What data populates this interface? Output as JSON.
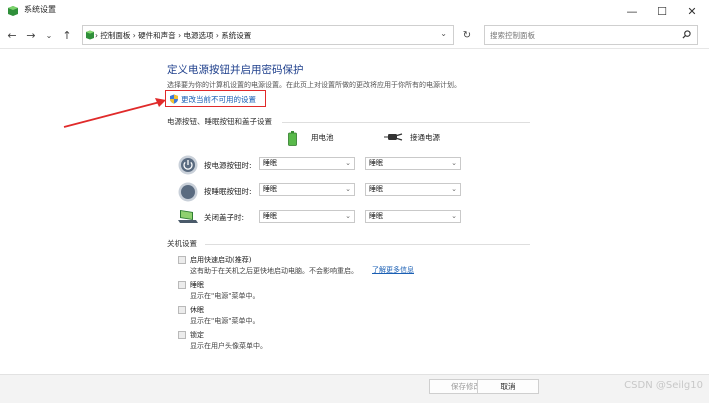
{
  "window": {
    "title": "系统设置",
    "controls": {
      "minimize": "—",
      "maximize": "☐",
      "close": "✕"
    }
  },
  "nav": {
    "breadcrumb": [
      "控制面板",
      "硬件和声音",
      "电源选项",
      "系统设置"
    ],
    "search_placeholder": "搜索控制面板",
    "icons": [
      "back-arrow-icon",
      "forward-arrow-icon",
      "chevron-down-icon",
      "up-arrow-icon",
      "refresh-icon",
      "search-icon"
    ]
  },
  "main": {
    "heading": "定义电源按钮并启用密码保护",
    "subtitle": "选择要为你的计算机设置的电源设置。在此页上对设置所做的更改将应用于你所有的电源计划。",
    "change_link": "更改当前不可用的设置",
    "buttons_section": {
      "title": "电源按钮、睡眠按钮和盖子设置",
      "col_battery": "用电池",
      "col_plugged": "接通电源",
      "rows": [
        {
          "label": "按电源按钮时:",
          "battery": "睡眠",
          "plugged": "睡眠"
        },
        {
          "label": "按睡眠按钮时:",
          "battery": "睡眠",
          "plugged": "睡眠"
        },
        {
          "label": "关闭盖子时:",
          "battery": "睡眠",
          "plugged": "睡眠"
        }
      ]
    },
    "shutdown_section": {
      "title": "关机设置",
      "items": [
        {
          "label": "启用快速启动(推荐)",
          "desc": "这有助于在关机之后更快地启动电脑。不会影响重启。",
          "link": "了解更多信息"
        },
        {
          "label": "睡眠",
          "desc": "显示在\"电源\"菜单中。"
        },
        {
          "label": "休眠",
          "desc": "显示在\"电源\"菜单中。"
        },
        {
          "label": "锁定",
          "desc": "显示在用户头像菜单中。"
        }
      ]
    }
  },
  "footer": {
    "save": "保存修改",
    "cancel": "取消"
  },
  "watermark": "CSDN @Seilg10",
  "colors": {
    "accent_link": "#1a5fb4",
    "heading": "#1e3f8c",
    "highlight": "#e02a2a"
  }
}
